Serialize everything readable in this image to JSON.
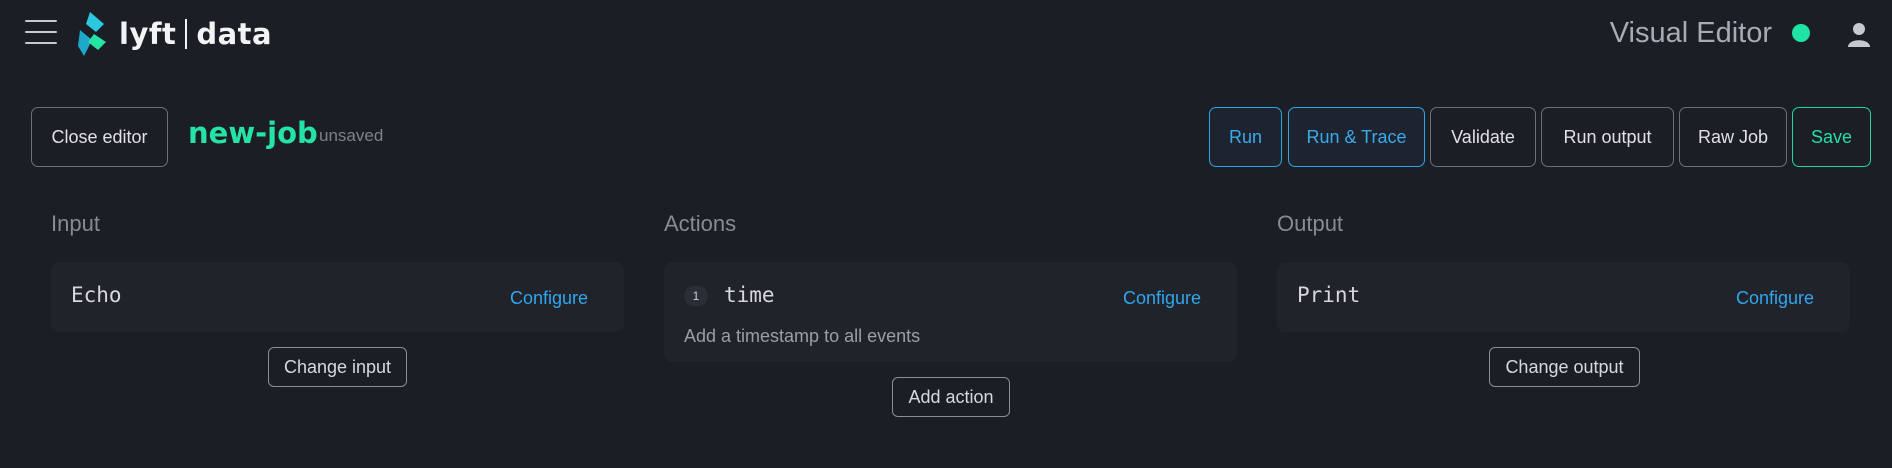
{
  "topbar": {
    "logo_word": "lyft",
    "logo_word2": "data",
    "app_title": "Visual Editor",
    "status_color": "#1ee3a3",
    "icons": {
      "menu": "hamburger-menu-icon",
      "logo": "lyftdata-logo-icon",
      "status": "connection-status-dot",
      "user": "user-icon"
    }
  },
  "header": {
    "close_label": "Close editor",
    "job_name": "new-job",
    "job_status": "unsaved",
    "buttons": {
      "run": "Run",
      "run_trace": "Run & Trace",
      "validate": "Validate",
      "run_output": "Run output",
      "raw_job": "Raw Job",
      "save": "Save"
    }
  },
  "columns": {
    "input": {
      "title": "Input",
      "card": {
        "name": "Echo",
        "configure": "Configure"
      },
      "button": "Change input"
    },
    "actions": {
      "title": "Actions",
      "items": [
        {
          "step": "1",
          "name": "time",
          "configure": "Configure",
          "description": "Add a timestamp to all events"
        }
      ],
      "button": "Add action"
    },
    "output": {
      "title": "Output",
      "card": {
        "name": "Print",
        "configure": "Configure"
      },
      "button": "Change output"
    }
  },
  "colors": {
    "background": "#1b1e25",
    "card": "#20232a",
    "accent_green": "#25e3a5",
    "accent_blue": "#2fa6ee"
  }
}
